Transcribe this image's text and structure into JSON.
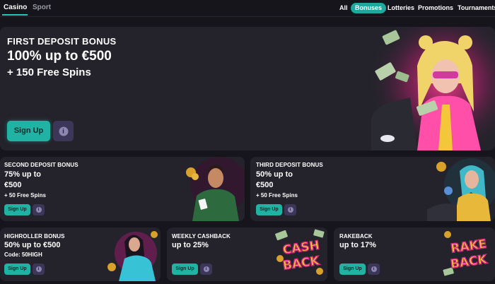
{
  "nav": {
    "tabs": [
      "Casino",
      "Sport"
    ],
    "pills": [
      "All",
      "Bonuses",
      "Lotteries",
      "Promotions",
      "Tournaments"
    ]
  },
  "hero": {
    "subtitle": "FIRST DEPOSIT BONUS",
    "title": "100% up to €500",
    "spins": "+ 150 Free Spins",
    "button": "Sign Up",
    "info": "i"
  },
  "cards": [
    {
      "title": "SECOND DEPOSIT BONUS",
      "line1": "75% up to",
      "line2": "€500",
      "extra": "+ 50 Free Spins",
      "button": "Sign Up",
      "info": "i"
    },
    {
      "title": "THIRD DEPOSIT BONUS",
      "line1": "50% up to",
      "line2": "€500",
      "extra": "+ 50 Free Spins",
      "button": "Sign Up",
      "info": "i"
    },
    {
      "title": "HIGHROLLER BONUS",
      "line1": "50% up to €500",
      "extra": "Code: 50HIGH",
      "button": "Sign Up",
      "info": "i"
    },
    {
      "title": "WEEKLY CASHBACK",
      "line1": "up to 25%",
      "button": "Sign Up",
      "info": "i",
      "art_text": [
        "CASH",
        "BACK"
      ]
    },
    {
      "title": "RAKEBACK",
      "line1": "up to 17%",
      "button": "Sign Up",
      "info": "i",
      "art_text": [
        "RAKE",
        "BACK"
      ]
    }
  ],
  "colors": {
    "accent": "#20b3a3",
    "card_bg": "#24232c",
    "page_bg": "#15151b",
    "info_bg": "#3c3759"
  }
}
